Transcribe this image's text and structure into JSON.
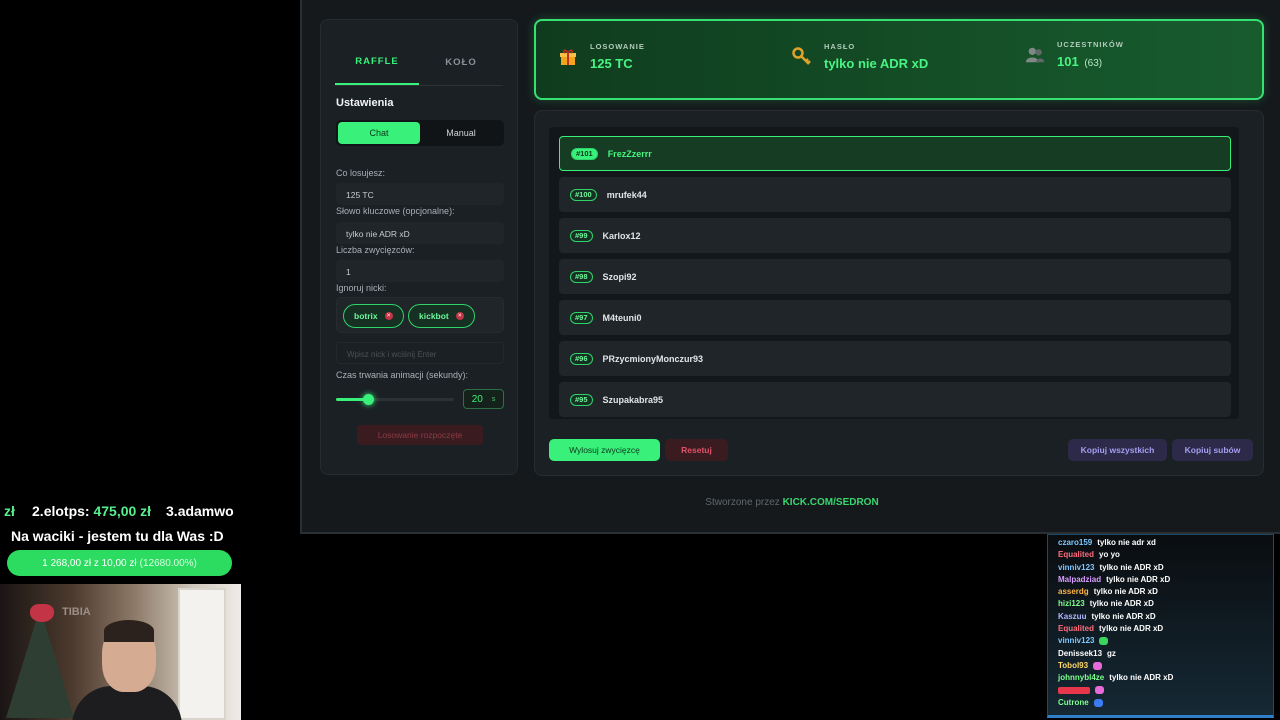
{
  "app": {
    "tabs": [
      "RAFFLE",
      "KOŁO"
    ],
    "section_title": "Ustawienia",
    "mode_options": [
      "Chat",
      "Manual"
    ],
    "fields": {
      "prize_label": "Co losujesz:",
      "prize_value": "125 TC",
      "keyword_label": "Słowo kluczowe (opcjonalne):",
      "keyword_value": "tylko nie ADR xD",
      "winners_label": "Liczba zwycięzców:",
      "winners_value": "1",
      "ignore_label": "Ignoruj nicki:",
      "ignore_chips": [
        "botrix",
        "kickbot"
      ],
      "nick_placeholder": "Wpisz nick i wciśnij Enter",
      "duration_label": "Czas trwania animacji (sekundy):",
      "duration_value": "20",
      "duration_unit": "s",
      "duration_level": 0.27
    },
    "start_status": "Losowanie rozpoczęte",
    "header": {
      "prize_label": "LOSOWANIE",
      "prize_value": "125 TC",
      "password_label": "HASŁO",
      "password_value": "tylko nie ADR xD",
      "participants_label": "UCZESTNIKÓW",
      "participants_value": "101",
      "participants_sub": "(63)"
    },
    "participants": [
      {
        "num": "#101",
        "name": "FrezZzerrr"
      },
      {
        "num": "#100",
        "name": "mrufek44"
      },
      {
        "num": "#99",
        "name": "Karlox12"
      },
      {
        "num": "#98",
        "name": "Szopi92"
      },
      {
        "num": "#97",
        "name": "M4teuni0"
      },
      {
        "num": "#96",
        "name": "PRzycmionyMonczur93"
      },
      {
        "num": "#95",
        "name": "Szupakabra95"
      }
    ],
    "buttons": {
      "draw": "Wylosuj zwycięzcę",
      "reset": "Resetuj",
      "copy_all": "Kopiuj wszystkich",
      "copy_subs": "Kopiuj subów"
    },
    "footer_prefix": "Stworzone przez ",
    "footer_link": "KICK.COM/SEDRON",
    "colors": {
      "accent": "#38f07a",
      "danger": "#e0506a",
      "purple": "#a79df1"
    }
  },
  "overlay": {
    "donors": [
      {
        "rank": "zł",
        "name": "",
        "amount": ""
      },
      {
        "rank": "2.",
        "name": "elotps: ",
        "amount": "475,00 zł"
      },
      {
        "rank": "3.",
        "name": "adamwo",
        "amount": ""
      }
    ],
    "slogan": "Na waciki - jestem tu dla Was :D",
    "goal_text": "1 268,00 zł  z  10,00 zł",
    "goal_pct": "(12680.00%)",
    "cam_logo": "TIBIA",
    "chat": [
      {
        "user": "czaro159",
        "text": "tylko nie adr xd",
        "color": "#7ec8ff"
      },
      {
        "user": "Equalited",
        "text": "yo yo",
        "color": "#ff6b7d"
      },
      {
        "user": "vinniv123",
        "text": "tylko nie ADR xD",
        "color": "#7ec8ff"
      },
      {
        "user": "Malpadziad",
        "text": "tylko nie ADR xD",
        "color": "#d99cff"
      },
      {
        "user": "asserdg",
        "text": "tylko nie ADR xD",
        "color": "#ffb347"
      },
      {
        "user": "hizi123",
        "text": "tylko nie ADR xD",
        "color": "#7dff8c"
      },
      {
        "user": "Kaszuu",
        "text": "tylko nie ADR xD",
        "color": "#b0b8ff"
      },
      {
        "user": "Equalited",
        "text": "tylko nie ADR xD",
        "color": "#ff6b7d"
      },
      {
        "user": "vinniv123",
        "text": "",
        "color": "#7ec8ff",
        "emote": "#3bd45f"
      },
      {
        "user": "Denissek13",
        "text": "gz",
        "color": "#ffffff"
      },
      {
        "user": "Tobol93",
        "text": "",
        "color": "#ffd966",
        "emote": "#e86ad9"
      },
      {
        "user": "johnnybl4ze",
        "text": "tylko nie ADR xD",
        "color": "#7dff8c"
      },
      {
        "user": "",
        "text": "",
        "color": "#e8364a",
        "emote": "#e86ad9"
      },
      {
        "user": "Cutrone",
        "text": "",
        "color": "#7dff8c",
        "emote": "#3d7cf0"
      }
    ]
  }
}
